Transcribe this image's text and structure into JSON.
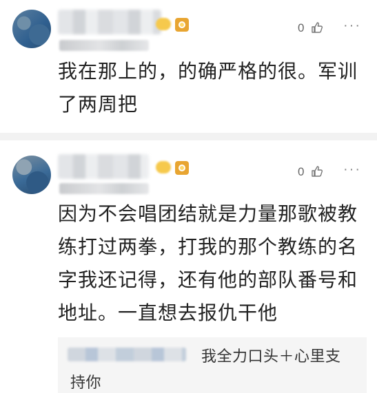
{
  "comments": [
    {
      "likes": "0",
      "more": "···",
      "text": "我在那上的，的确严格的很。军训了两周把"
    },
    {
      "likes": "0",
      "more": "···",
      "text": "因为不会唱团结就是力量那歌被教练打过两拳，打我的那个教练的名字我还记得，还有他的部队番号和地址。一直想去报仇干他"
    }
  ],
  "reply_preview": {
    "text": "我全力口头＋心里支持你"
  },
  "icons": {
    "like": "thumbs-up-icon",
    "more": "more-options-icon",
    "medal": "medal-icon"
  },
  "colors": {
    "text": "#222222",
    "meta": "#666666",
    "divider": "#f2f2f2",
    "reply_bg": "#f5f5f5",
    "medal": "#e8a531"
  }
}
